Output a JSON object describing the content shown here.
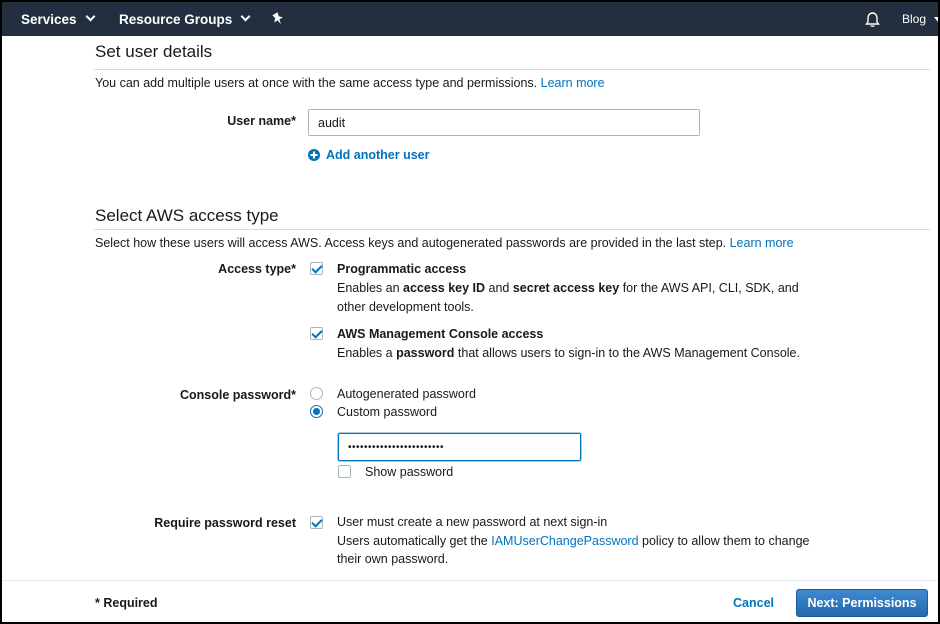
{
  "topbar": {
    "services_label": "Services",
    "resource_groups_label": "Resource Groups",
    "account_label": "Blog"
  },
  "user_details": {
    "heading": "Set user details",
    "description": "You can add multiple users at once with the same access type and permissions.",
    "learn_more": "Learn more",
    "user_name_label": "User name*",
    "user_name_value": "audit",
    "add_another_user": "Add another user"
  },
  "access_type": {
    "heading": "Select AWS access type",
    "description": "Select how these users will access AWS. Access keys and autogenerated passwords are provided in the last step.",
    "learn_more": "Learn more",
    "label": "Access type*",
    "programmatic": {
      "title": "Programmatic access",
      "checked": true,
      "line1_a": "Enables an ",
      "line1_b": "access key ID",
      "line1_c": " and ",
      "line1_d": "secret access key",
      "line1_e": " for the AWS API, CLI, SDK, and",
      "line2": "other development tools."
    },
    "console": {
      "title": "AWS Management Console access",
      "checked": true,
      "line1_a": "Enables a ",
      "line1_b": "password",
      "line1_c": " that allows users to sign-in to the AWS Management Console."
    }
  },
  "console_password": {
    "label": "Console password*",
    "options": [
      "Autogenerated password",
      "Custom password"
    ],
    "selected": "Custom password",
    "password_value": "••••••••••••••••••••••••",
    "show_password_label": "Show password",
    "show_password_checked": false
  },
  "password_reset": {
    "label": "Require password reset",
    "checked": true,
    "line1": "User must create a new password at next sign-in",
    "line2_a": "Users automatically get the ",
    "line2_link": "IAMUserChangePassword",
    "line2_b": " policy to allow them to change",
    "line3": "their own password."
  },
  "footer": {
    "required_note": "* Required",
    "cancel_label": "Cancel",
    "next_label": "Next: Permissions"
  },
  "colors": {
    "nav_bg": "#232f3e",
    "link": "#0073bb",
    "primary_button": "#2e73b8"
  }
}
